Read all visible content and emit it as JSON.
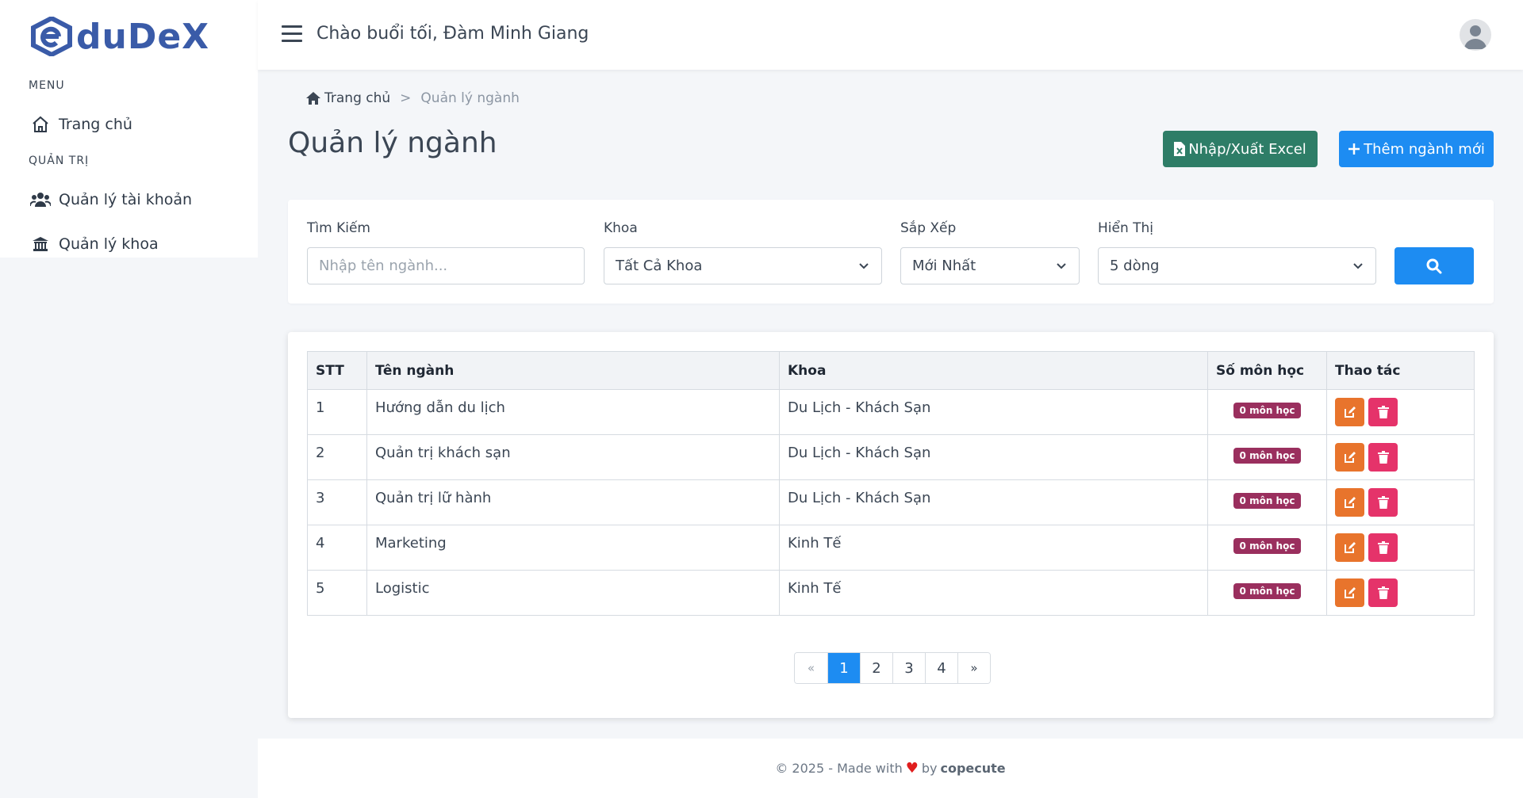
{
  "app": {
    "logo_text": "duDeX"
  },
  "header": {
    "greeting": "Chào buổi tối, Đàm Minh Giang"
  },
  "sidebar": {
    "sections": [
      {
        "title": "MENU",
        "items": [
          {
            "label": "Trang chủ",
            "icon": "home-icon"
          }
        ]
      },
      {
        "title": "QUẢN TRỊ",
        "items": [
          {
            "label": "Quản lý tài khoản",
            "icon": "users-icon"
          },
          {
            "label": "Quản lý khoa",
            "icon": "institution-icon"
          }
        ]
      }
    ]
  },
  "breadcrumb": {
    "home": "Trang chủ",
    "separator": ">",
    "current": "Quản lý ngành"
  },
  "page": {
    "title": "Quản lý ngành"
  },
  "actions": {
    "excel_label": "Nhập/Xuất Excel",
    "add_label": "Thêm ngành mới"
  },
  "filters": {
    "search": {
      "label": "Tìm Kiếm",
      "placeholder": "Nhập tên ngành..."
    },
    "faculty": {
      "label": "Khoa",
      "value": "Tất Cả Khoa"
    },
    "sort": {
      "label": "Sắp Xếp",
      "value": "Mới Nhất"
    },
    "display": {
      "label": "Hiển Thị",
      "value": "5 dòng"
    }
  },
  "table": {
    "headers": [
      "STT",
      "Tên ngành",
      "Khoa",
      "Số môn học",
      "Thao tác"
    ],
    "rows": [
      {
        "stt": "1",
        "name": "Hướng dẫn du lịch",
        "faculty": "Du Lịch - Khách Sạn",
        "subjects": "0 môn học"
      },
      {
        "stt": "2",
        "name": "Quản trị khách sạn",
        "faculty": "Du Lịch - Khách Sạn",
        "subjects": "0 môn học"
      },
      {
        "stt": "3",
        "name": "Quản trị lữ hành",
        "faculty": "Du Lịch - Khách Sạn",
        "subjects": "0 môn học"
      },
      {
        "stt": "4",
        "name": "Marketing",
        "faculty": "Kinh Tế",
        "subjects": "0 môn học"
      },
      {
        "stt": "5",
        "name": "Logistic",
        "faculty": "Kinh Tế",
        "subjects": "0 môn học"
      }
    ]
  },
  "pagination": {
    "prev": "«",
    "pages": [
      "1",
      "2",
      "3",
      "4"
    ],
    "active": "1",
    "next": "»"
  },
  "footer": {
    "prefix": "© 2025 - Made with",
    "by": "by",
    "author": "copecute"
  },
  "colors": {
    "primary": "#1d8cf2",
    "excel": "#2e7d67",
    "badge": "#9a2f5e",
    "edit": "#e8742c",
    "delete": "#e5336a",
    "logo": "#3a5ba8"
  }
}
